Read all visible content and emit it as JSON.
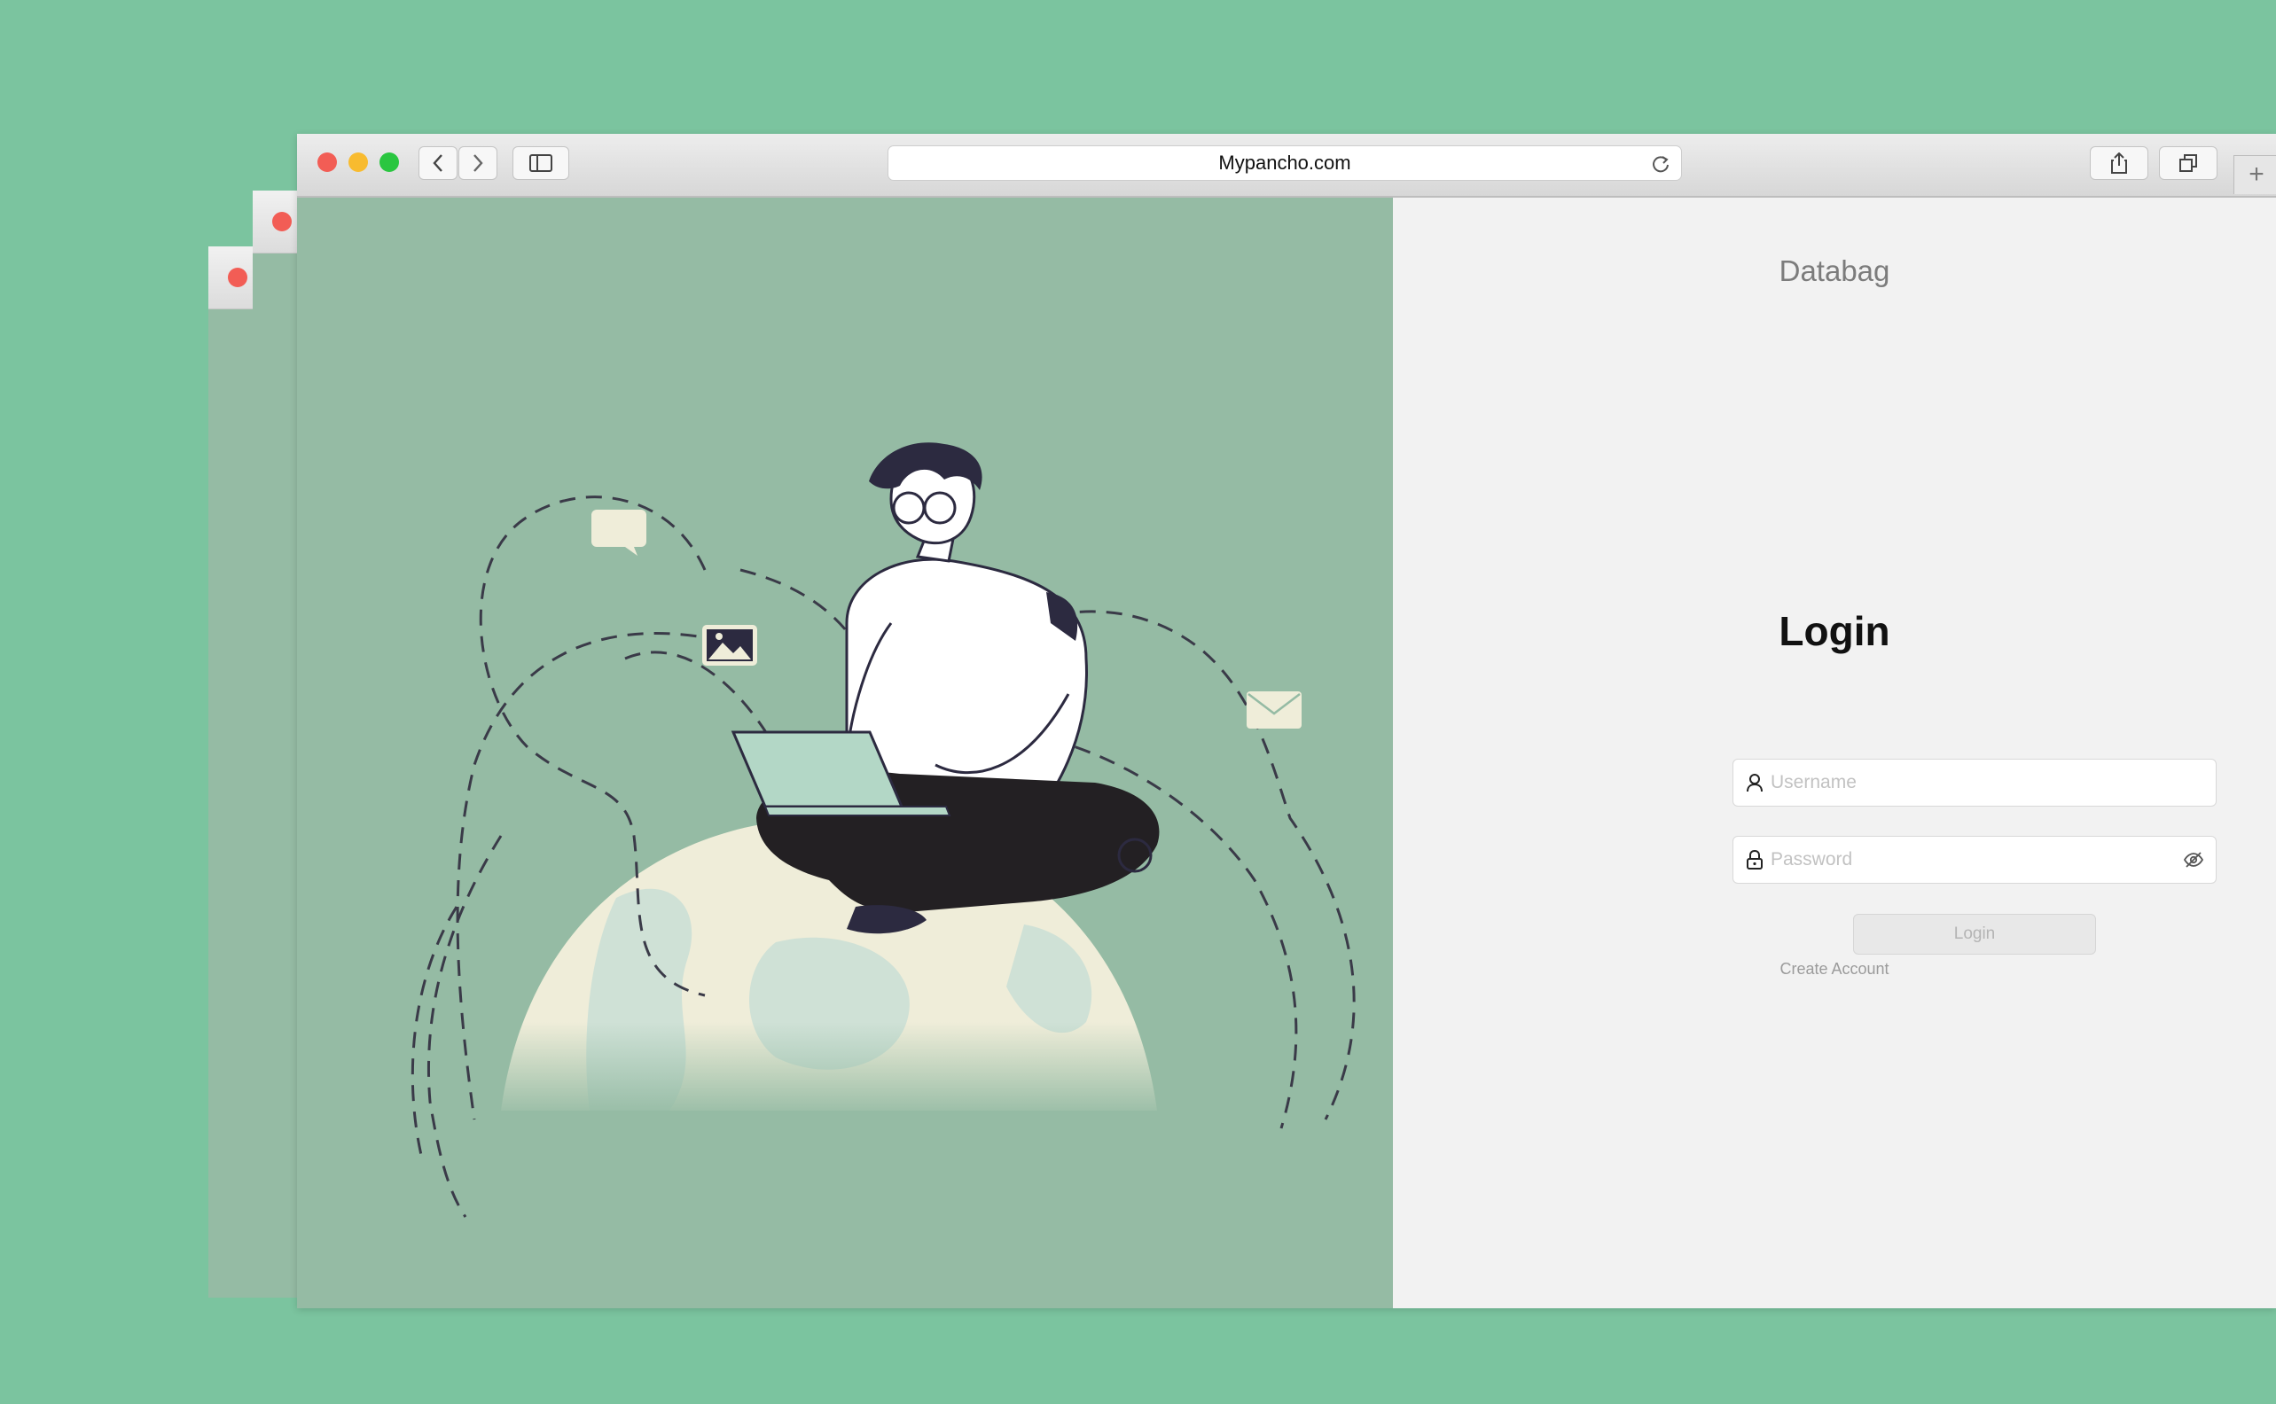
{
  "browser": {
    "url": "Mypancho.com",
    "new_tab_glyph": "+",
    "icons": [
      "back-icon",
      "forward-icon",
      "sidebar-icon",
      "reload-icon",
      "share-icon",
      "tabs-icon"
    ],
    "traffic_colors": {
      "close": "#f25d55",
      "minimize": "#f8bb2f",
      "maximize": "#2ac640"
    }
  },
  "app": {
    "title": "Databag",
    "heading": "Login",
    "username_placeholder": "Username",
    "password_placeholder": "Password",
    "login_button": "Login",
    "create_account": "Create Account"
  },
  "colors": {
    "desktop": "#7bc49f",
    "illustration_bg": "#95bba4",
    "panel_bg": "#f2f2f2"
  }
}
